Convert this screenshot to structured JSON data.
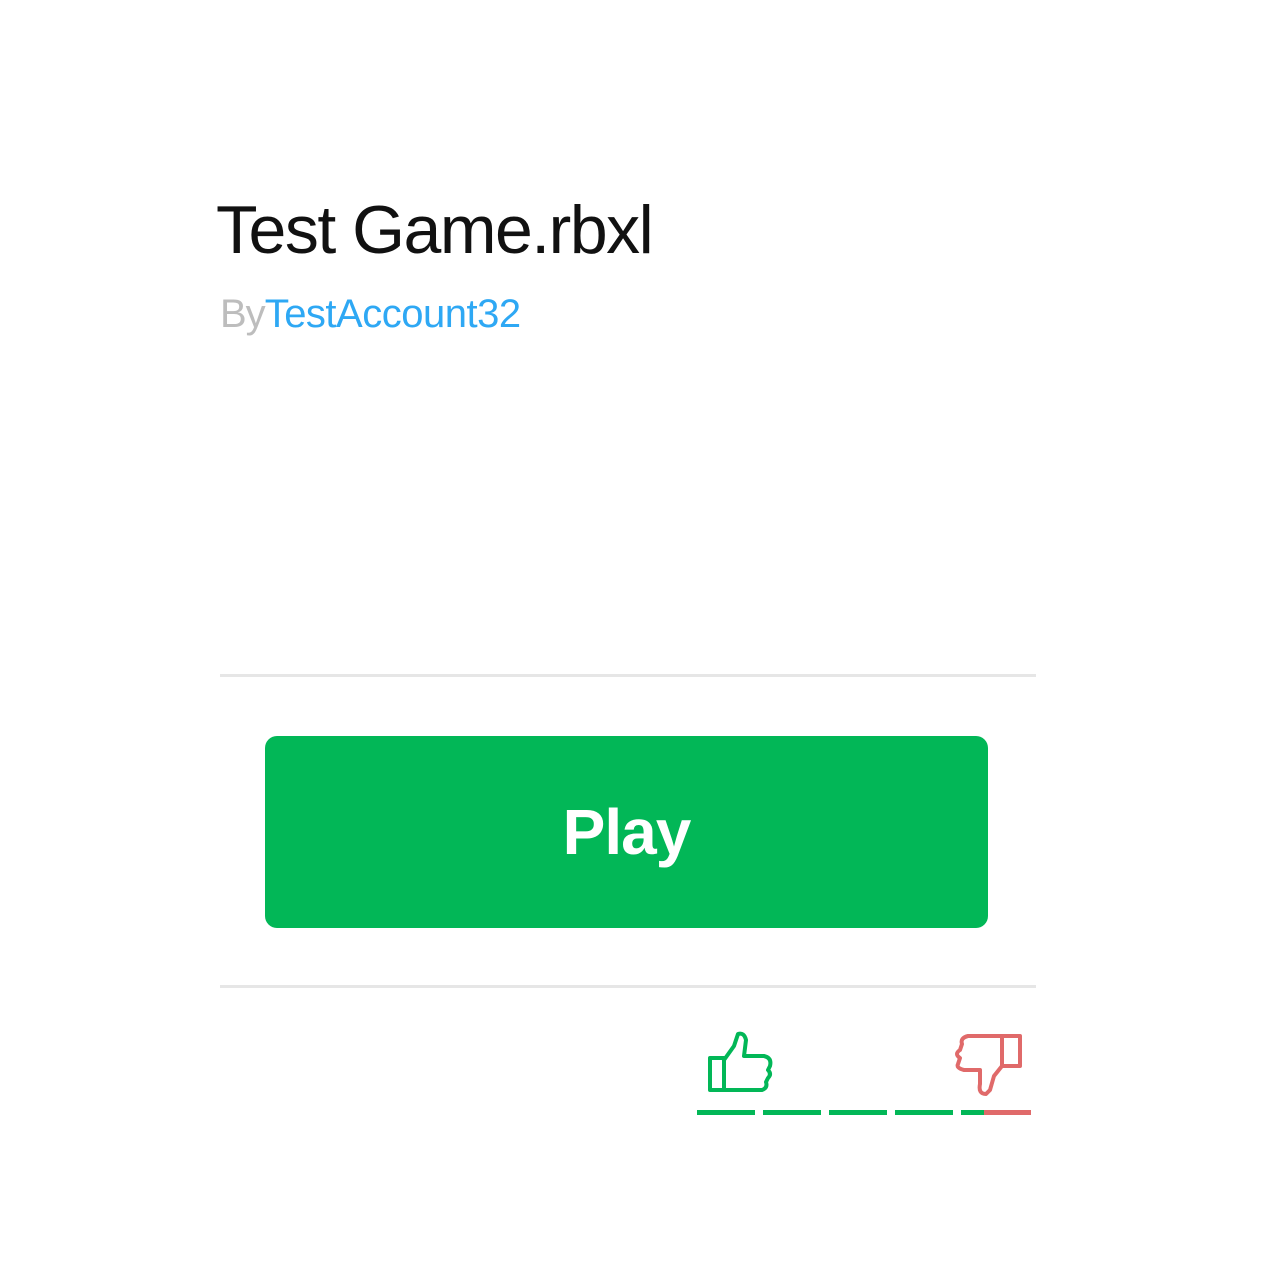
{
  "game": {
    "title": "Test Game.rbxl",
    "by_label": "By",
    "creator": "TestAccount32"
  },
  "actions": {
    "play_label": "Play"
  },
  "votes": {
    "upvote_fraction": 0.86,
    "up_icon": "thumbs-up-icon",
    "down_icon": "thumbs-down-icon"
  },
  "colors": {
    "play_button": "#02b757",
    "creator_link": "#2ea8f4",
    "upvote": "#02b757",
    "downvote": "#e06a6a"
  }
}
